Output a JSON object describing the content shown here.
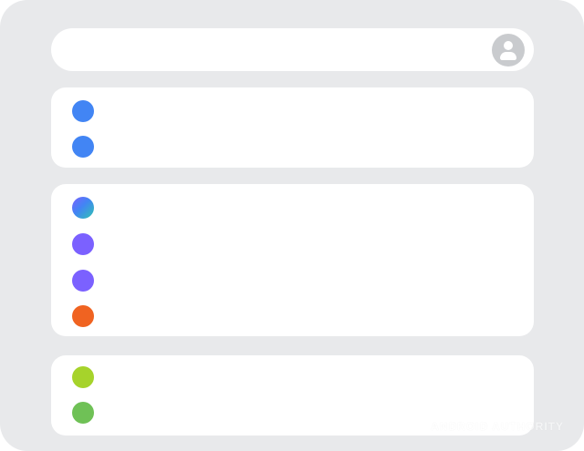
{
  "header": {
    "avatar_icon": "account-circle-icon"
  },
  "sections": [
    {
      "items": [
        {
          "icon": "dot",
          "color": "#4285f4",
          "label": ""
        },
        {
          "icon": "dot",
          "color": "#4285f4",
          "label": ""
        }
      ]
    },
    {
      "items": [
        {
          "icon": "dot",
          "color": "gradient:#4285f4,#2fc4b2",
          "label": ""
        },
        {
          "icon": "dot",
          "color": "#7b61ff",
          "label": ""
        },
        {
          "icon": "dot",
          "color": "#7b61ff",
          "label": ""
        },
        {
          "icon": "dot",
          "color": "#f06321",
          "label": ""
        }
      ]
    },
    {
      "items": [
        {
          "icon": "dot",
          "color": "#a6d32b",
          "label": ""
        },
        {
          "icon": "dot",
          "color": "#6fc156",
          "label": ""
        }
      ]
    }
  ],
  "watermark": "ANDROID AUTHORITY"
}
